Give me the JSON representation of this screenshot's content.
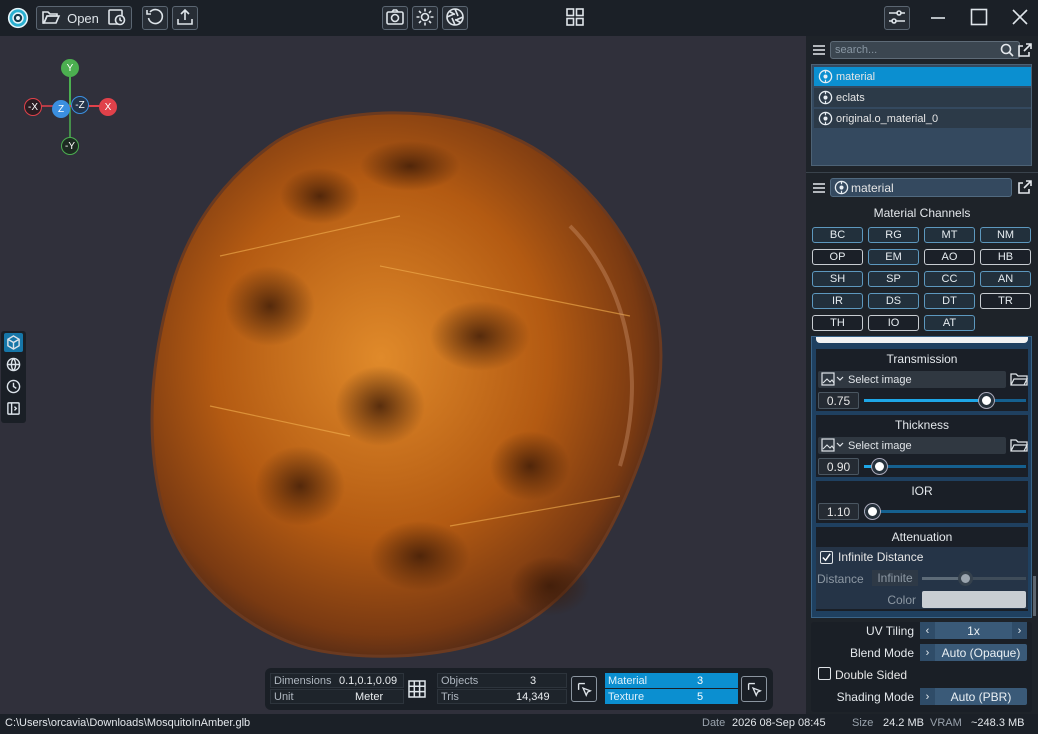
{
  "toolbar": {
    "open_label": "Open",
    "icons": [
      "app-logo-icon",
      "folder-open-icon",
      "history-icon",
      "undo-icon",
      "export-icon",
      "camera-icon",
      "light-icon",
      "aperture-icon",
      "layout-grid-icon",
      "settings-sliders-icon",
      "minimize-icon",
      "maximize-icon",
      "close-icon"
    ]
  },
  "gizmo": {
    "y_pos": "Y",
    "y_neg": "-Y",
    "x_pos": "X",
    "x_neg": "-X",
    "z_pos": "Z",
    "z_neg": "-Z",
    "colors": {
      "y": "#4caf50",
      "x": "#e0414a",
      "z": "#3b8fe0"
    }
  },
  "stats": {
    "dimensions_label": "Dimensions",
    "dimensions_value": "0.1,0.1,0.09",
    "unit_label": "Unit",
    "unit_value": "Meter",
    "objects_label": "Objects",
    "objects_value": "3",
    "tris_label": "Tris",
    "tris_value": "14,349",
    "material_label": "Material",
    "material_value": "3",
    "texture_label": "Texture",
    "texture_value": "5"
  },
  "statusbar": {
    "path": "C:\\Users\\orcavia\\Downloads\\MosquitoInAmber.glb",
    "date_label": "Date",
    "date_value": "2026 08-Sep 08:45",
    "size_label": "Size",
    "size_value": "24.2 MB",
    "vram_label": "VRAM",
    "vram_value": "~248.3 MB"
  },
  "scene": {
    "search_placeholder": "search...",
    "items": [
      {
        "label": "material",
        "selected": true
      },
      {
        "label": "eclats",
        "selected": false
      },
      {
        "label": "original.o_material_0",
        "selected": false
      }
    ]
  },
  "material_panel": {
    "selected_material": "material",
    "channels_title": "Material Channels",
    "channels": [
      "BC",
      "RG",
      "MT",
      "NM",
      "OP",
      "EM",
      "AO",
      "HB",
      "SH",
      "SP",
      "CC",
      "AN",
      "IR",
      "DS",
      "DT",
      "TR",
      "TH",
      "IO",
      "AT"
    ],
    "channels_off": [
      "OP",
      "AO",
      "HB",
      "TR",
      "TH",
      "IO"
    ],
    "transmission": {
      "title": "Transmission",
      "image_placeholder": "Select image",
      "value": "0.75",
      "fraction": 0.75
    },
    "thickness": {
      "title": "Thickness",
      "image_placeholder": "Select image",
      "value": "0.90",
      "fraction": 0.09
    },
    "ior": {
      "title": "IOR",
      "value": "1.10",
      "fraction": 0.05
    },
    "attenuation": {
      "title": "Attenuation",
      "infinite_distance_label": "Infinite Distance",
      "infinite_distance_checked": true,
      "distance_label": "Distance",
      "distance_value": "Infinite",
      "color_label": "Color",
      "color_value": "#c9ced3"
    },
    "uv_tiling_label": "UV Tiling",
    "uv_tiling_value": "1x",
    "blend_mode_label": "Blend Mode",
    "blend_mode_value": "Auto (Opaque)",
    "double_sided_label": "Double Sided",
    "double_sided_checked": false,
    "shading_mode_label": "Shading Mode",
    "shading_mode_value": "Auto (PBR)"
  },
  "side_tools": [
    "cube-view-icon",
    "globe-icon",
    "clock-icon",
    "panel-icon"
  ]
}
